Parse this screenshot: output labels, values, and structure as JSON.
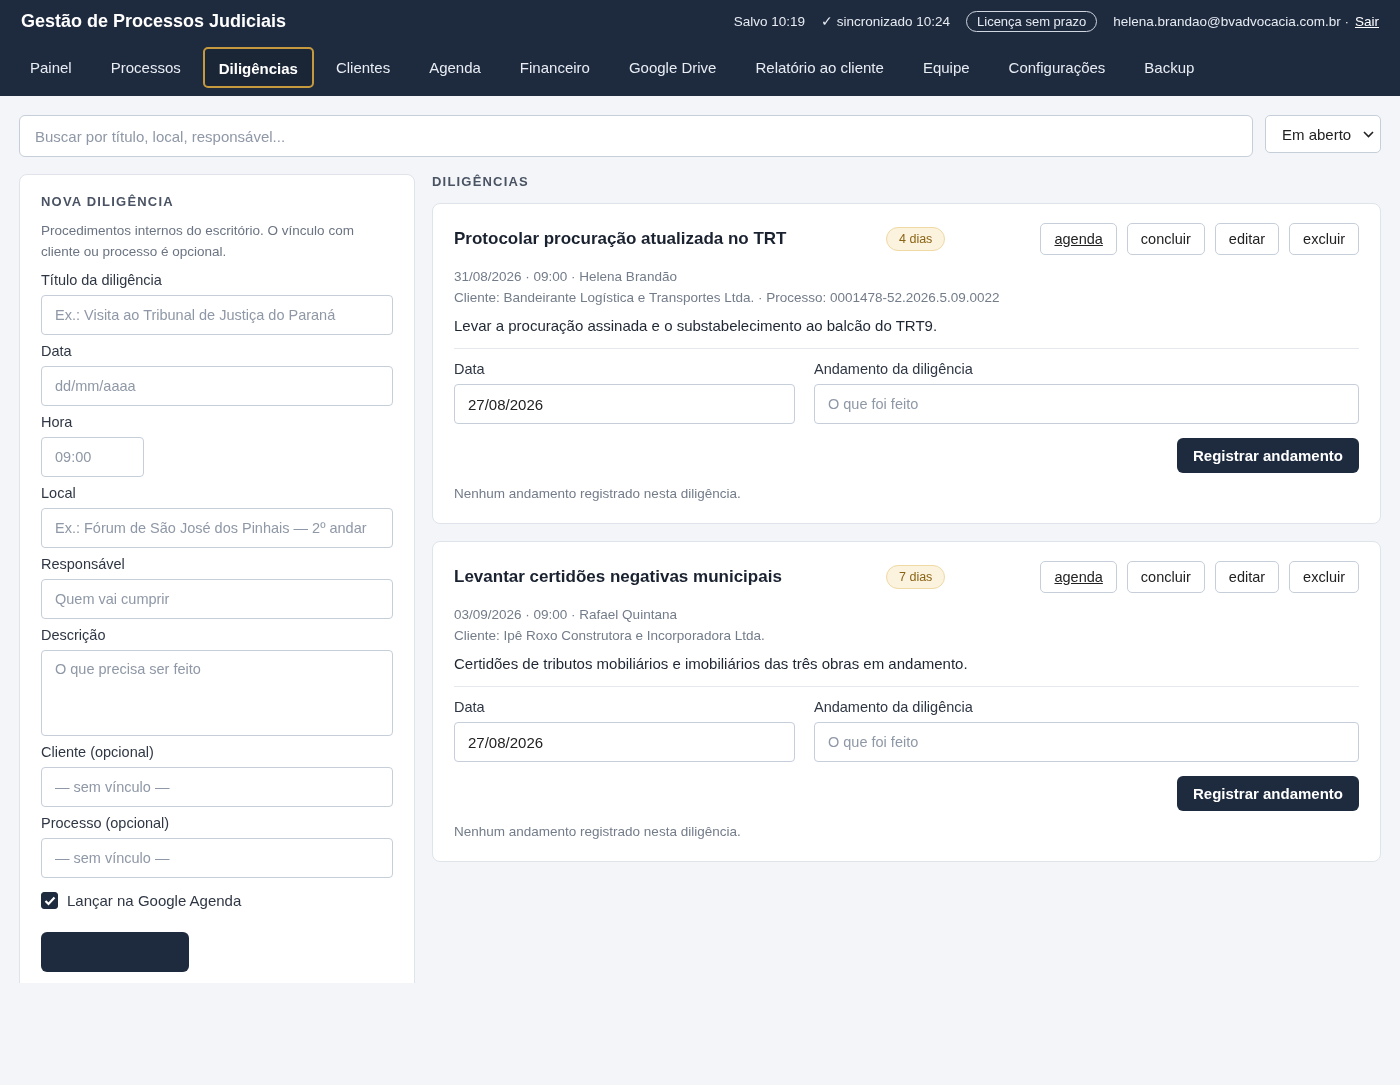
{
  "app_title": "Gestão de Processos Judiciais",
  "status": {
    "saved": "Salvo 10:19",
    "synced": "✓ sincronizado 10:24",
    "license": "Licença sem prazo",
    "email": "helena.brandao@bvadvocacia.com.br ·",
    "logout": "Sair"
  },
  "tabs": [
    {
      "label": "Painel",
      "selected": false
    },
    {
      "label": "Processos",
      "selected": false
    },
    {
      "label": "Diligências",
      "selected": true
    },
    {
      "label": "Clientes",
      "selected": false
    },
    {
      "label": "Agenda",
      "selected": false
    },
    {
      "label": "Financeiro",
      "selected": false
    },
    {
      "label": "Google Drive",
      "selected": false
    },
    {
      "label": "Relatório ao cliente",
      "selected": false
    },
    {
      "label": "Equipe",
      "selected": false
    },
    {
      "label": "Configurações",
      "selected": false
    },
    {
      "label": "Backup",
      "selected": false
    }
  ],
  "search": {
    "placeholder": "Buscar por título, local, responsável..."
  },
  "filter": {
    "value": "Em aberto"
  },
  "form": {
    "heading": "NOVA DILIGÊNCIA",
    "description": "Procedimentos internos do escritório. O vínculo com cliente ou processo é opcional.",
    "fields": [
      {
        "label": "Título da diligência",
        "placeholder": "Ex.: Visita ao Tribunal de Justiça do Paraná",
        "kind": "text"
      },
      {
        "label": "Data",
        "placeholder": "dd/mm/aaaa",
        "kind": "text"
      },
      {
        "label": "Hora",
        "placeholder": "09:00",
        "kind": "short"
      },
      {
        "label": "Local",
        "placeholder": "Ex.: Fórum de São José dos Pinhais — 2º andar",
        "kind": "text"
      },
      {
        "label": "Responsável",
        "placeholder": "Quem vai cumprir",
        "kind": "text"
      },
      {
        "label": "Descrição",
        "placeholder": "O que precisa ser feito",
        "kind": "textarea"
      },
      {
        "label": "Cliente (opcional)",
        "placeholder": "— sem vínculo —",
        "kind": "text"
      },
      {
        "label": "Processo (opcional)",
        "placeholder": "— sem vínculo —",
        "kind": "text"
      }
    ],
    "checkbox": {
      "label": "Lançar na Google Agenda",
      "checked": true
    }
  },
  "list_heading": "DILIGÊNCIAS",
  "cards": [
    {
      "title": "Protocolar procuração atualizada no TRT",
      "badge": "4 dias",
      "actions": [
        "agenda",
        "concluir",
        "editar",
        "excluir"
      ],
      "meta": "31/08/2026 · 09:00 · Helena Brandão",
      "client_line": "Cliente: Bandeirante Logística e Transportes Ltda. · Processo: 0001478-52.2026.5.09.0022",
      "description": "Levar a procuração assinada e o substabelecimento ao balcão do TRT9.",
      "date_label": "Data",
      "date_value": "27/08/2026",
      "progress_label": "Andamento da diligência",
      "progress_placeholder": "O que foi feito",
      "register_button": "Registrar andamento",
      "empty_note": "Nenhum andamento registrado nesta diligência."
    },
    {
      "title": "Levantar certidões negativas municipais",
      "badge": "7 dias",
      "actions": [
        "agenda",
        "concluir",
        "editar",
        "excluir"
      ],
      "meta": "03/09/2026 · 09:00 · Rafael Quintana",
      "client_line": "Cliente: Ipê Roxo Construtora e Incorporadora Ltda.",
      "description": "Certidões de tributos mobiliários e imobiliários das três obras em andamento.",
      "date_label": "Data",
      "date_value": "27/08/2026",
      "progress_label": "Andamento da diligência",
      "progress_placeholder": "O que foi feito",
      "register_button": "Registrar andamento",
      "empty_note": "Nenhum andamento registrado nesta diligência."
    }
  ]
}
